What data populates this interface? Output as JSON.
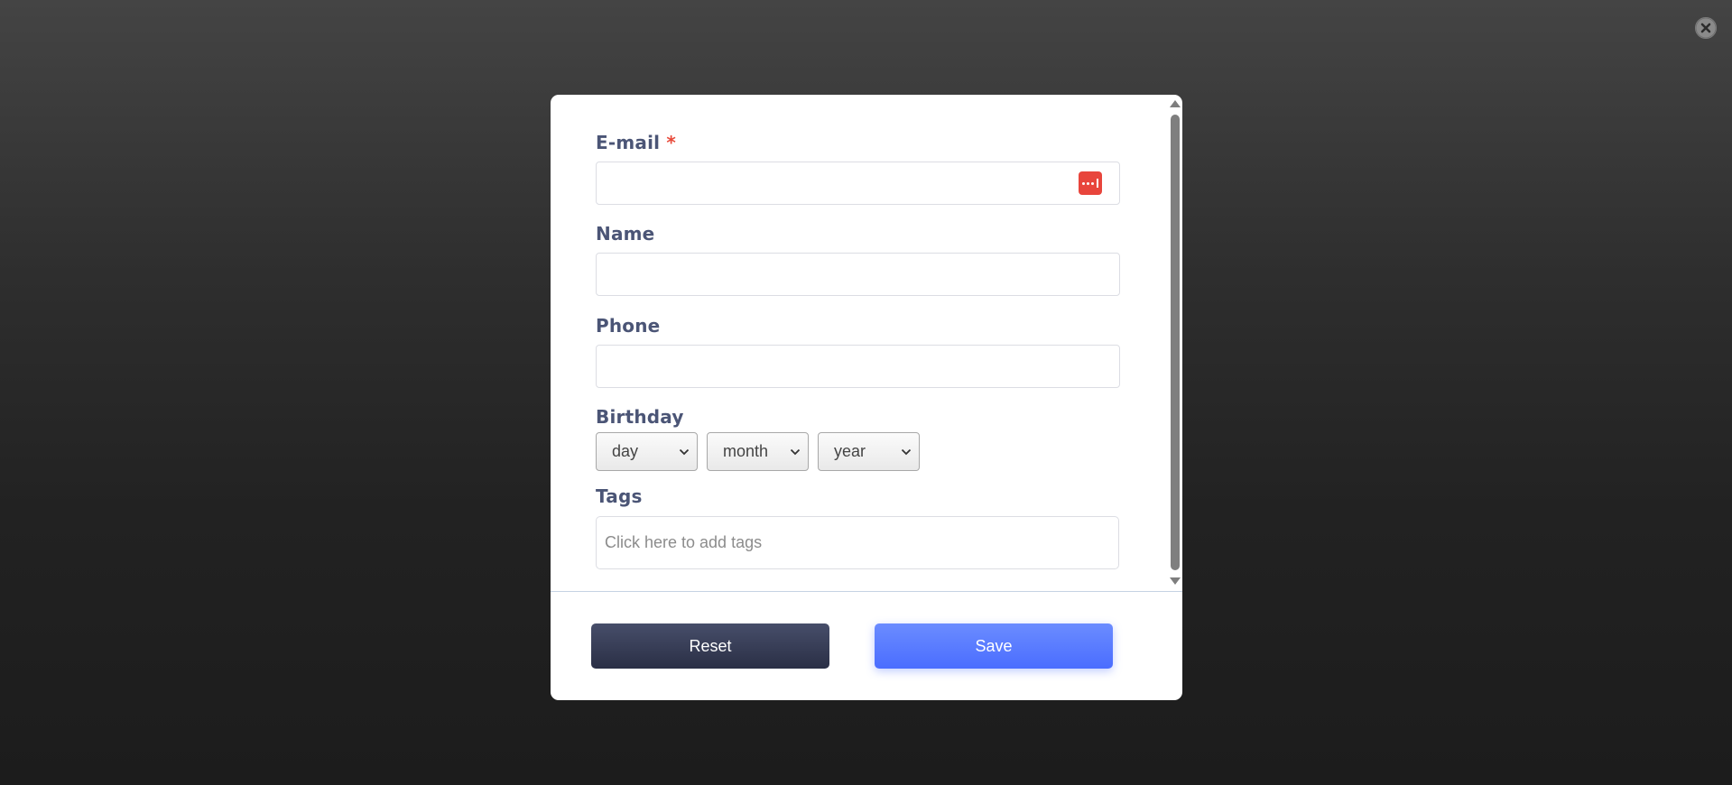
{
  "form": {
    "email": {
      "label": "E-mail",
      "required_mark": "*",
      "value": ""
    },
    "name": {
      "label": "Name",
      "value": ""
    },
    "phone": {
      "label": "Phone",
      "value": ""
    },
    "birthday": {
      "label": "Birthday",
      "day": "day",
      "month": "month",
      "year": "year"
    },
    "tags": {
      "label": "Tags",
      "placeholder": "Click here to add tags"
    }
  },
  "actions": {
    "reset_label": "Reset",
    "save_label": "Save"
  },
  "colors": {
    "label": "#4b5576",
    "required": "#e84a3a",
    "reset_button": "#363b54",
    "save_button": "#587bff",
    "password_manager_icon": "#e8453c"
  },
  "icons": {
    "overlay_close": "close-circle-icon",
    "email_field_addon": "password-manager-icon",
    "select_arrow": "chevron-down-icon"
  }
}
